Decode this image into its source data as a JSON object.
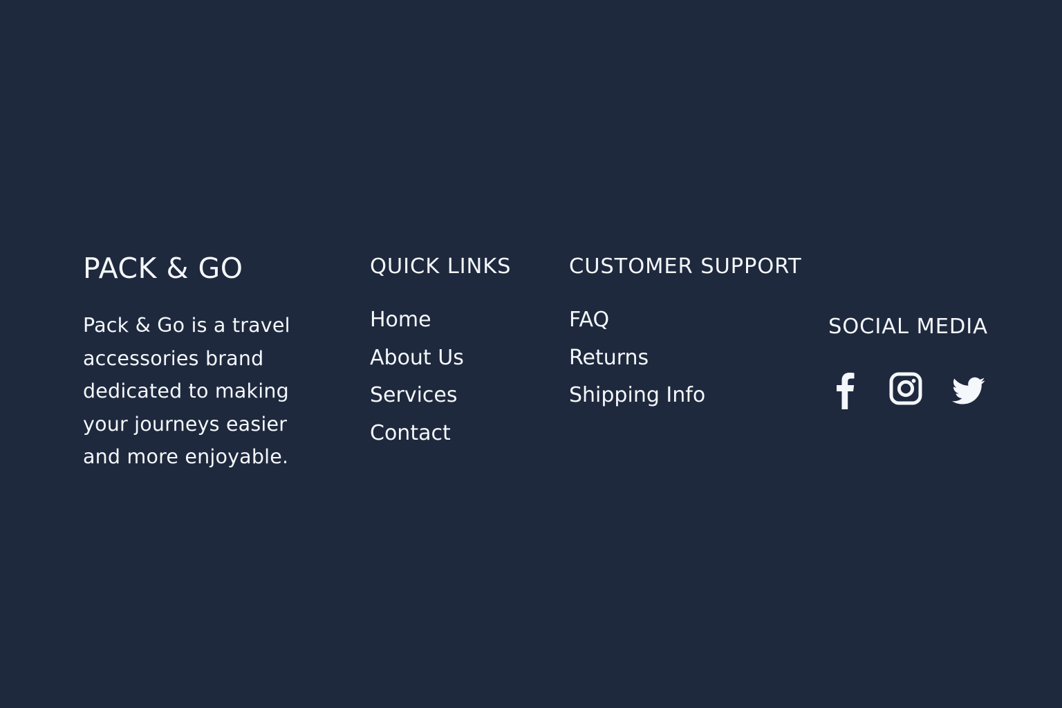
{
  "brand": {
    "title": "PACK & GO",
    "description": "Pack & Go is a travel accessories brand dedicated to making your journeys easier and more enjoyable."
  },
  "quick_links": {
    "heading": "QUICK LINKS",
    "items": [
      {
        "label": "Home"
      },
      {
        "label": "About Us"
      },
      {
        "label": "Services"
      },
      {
        "label": "Contact"
      }
    ]
  },
  "customer_support": {
    "heading": "CUSTOMER SUPPORT",
    "items": [
      {
        "label": "FAQ"
      },
      {
        "label": "Returns"
      },
      {
        "label": "Shipping Info"
      }
    ]
  },
  "social_media": {
    "heading": "SOCIAL MEDIA",
    "icons": [
      "facebook-icon",
      "instagram-icon",
      "twitter-icon"
    ]
  },
  "colors": {
    "background": "#1e293d",
    "text": "#f4f7fb"
  }
}
